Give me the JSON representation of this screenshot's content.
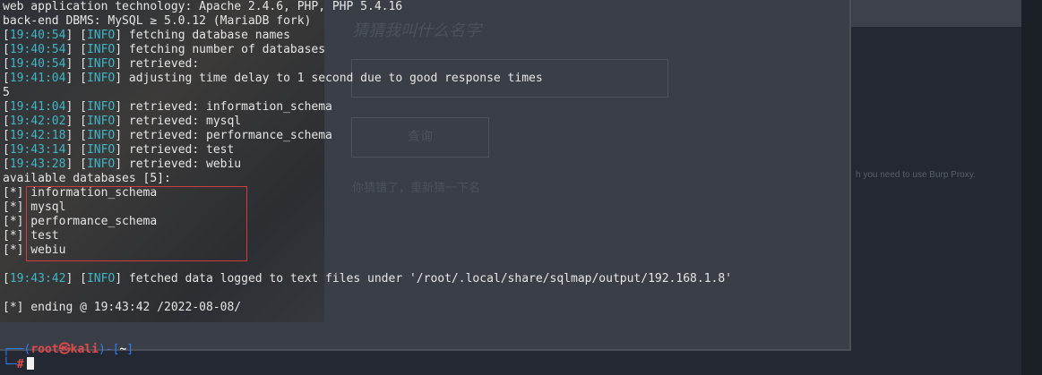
{
  "background_page": {
    "heading": "猜猜我叫什么名字",
    "query_button": "查询",
    "message": "你猜错了，重新猜一下名",
    "burp_hint": "h you need to use Burp Proxy."
  },
  "terminal": {
    "lines": [
      {
        "plain": "web application technology: Apache 2.4.6, PHP, PHP 5.4.16"
      },
      {
        "plain": "back-end DBMS: MySQL ≥ 5.0.12 (MariaDB fork)"
      },
      {
        "ts": "19:40:54",
        "tag": "INFO",
        "msg": "fetching database names"
      },
      {
        "ts": "19:40:54",
        "tag": "INFO",
        "msg": "fetching number of databases"
      },
      {
        "ts": "19:40:54",
        "tag": "INFO",
        "msg": "retrieved:"
      },
      {
        "ts": "19:41:04",
        "tag": "INFO",
        "msg": "adjusting time delay to 1 second due to good response times"
      },
      {
        "plain": "5"
      },
      {
        "ts": "19:41:04",
        "tag": "INFO",
        "msg": "retrieved: information_schema"
      },
      {
        "ts": "19:42:02",
        "tag": "INFO",
        "msg": "retrieved: mysql"
      },
      {
        "ts": "19:42:18",
        "tag": "INFO",
        "msg": "retrieved: performance_schema"
      },
      {
        "ts": "19:43:14",
        "tag": "INFO",
        "msg": "retrieved: test"
      },
      {
        "ts": "19:43:28",
        "tag": "INFO",
        "msg": "retrieved: webiu"
      },
      {
        "plain": "available databases [5]:"
      },
      {
        "plain": "[*] information_schema"
      },
      {
        "plain": "[*] mysql"
      },
      {
        "plain": "[*] performance_schema"
      },
      {
        "plain": "[*] test"
      },
      {
        "plain": "[*] webiu"
      },
      {
        "plain": ""
      },
      {
        "ts": "19:43:42",
        "tag": "INFO",
        "msg": "fetched data logged to text files under '/root/.local/share/sqlmap/output/192.168.1.8'"
      },
      {
        "plain": ""
      },
      {
        "plain": "[*] ending @ 19:43:42 /2022-08-08/"
      }
    ]
  },
  "prompt": {
    "user_host": "root㉿kali",
    "dir": "~",
    "symbol": "#"
  },
  "colors": {
    "timestamp": "#3fb6c6",
    "highlight_box": "#d23b3b",
    "prompt_user": "#e24a4a",
    "prompt_frame": "#2e7df2"
  }
}
